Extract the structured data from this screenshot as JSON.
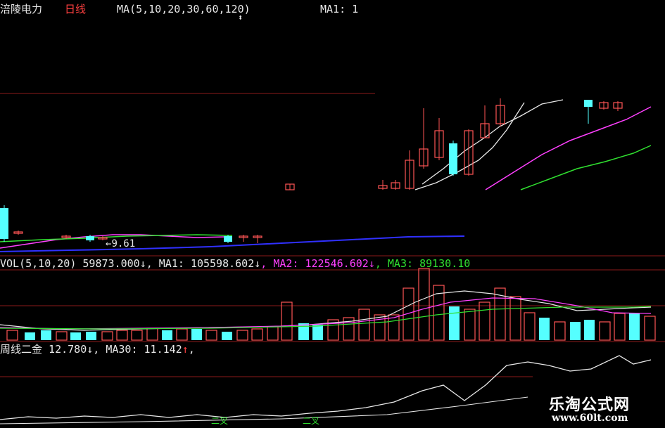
{
  "header": {
    "stock_name": "涪陵电力",
    "period": "日线",
    "ma_label": "MA(5,10,20,30,60,120)",
    "ma1_label": "MA1: 1"
  },
  "price_panel": {
    "marker_value": "9.61"
  },
  "volume_panel": {
    "title": "VOL(5,10,20)",
    "vol_value": "59873.000",
    "vol_arrow": "↓",
    "ma1_label": ", MA1:",
    "ma1_value": "105598.602",
    "ma1_arrow": "↓",
    "ma2_label": ", MA2:",
    "ma2_value": "122546.602",
    "ma2_arrow": "↓",
    "ma3_label": ", MA3:",
    "ma3_value": "89130.10"
  },
  "indicator_panel": {
    "title": "周线二金",
    "value": "12.780",
    "value_arrow": "↓",
    "ma30_label": ", MA30:",
    "ma30_value": "11.142",
    "ma30_arrow": "↑",
    "tail": ",",
    "signal_text": "二叉"
  },
  "watermark": {
    "title": "乐淘公式网",
    "url": "www.60lt.com"
  },
  "colors": {
    "up": "#ff5555",
    "down": "#55ffff",
    "grid": "#8b1a1a",
    "ma_white": "#e8e8e8",
    "ma_magenta": "#ff40ff",
    "ma_green": "#30e030",
    "ma_blue": "#3030ff"
  }
}
